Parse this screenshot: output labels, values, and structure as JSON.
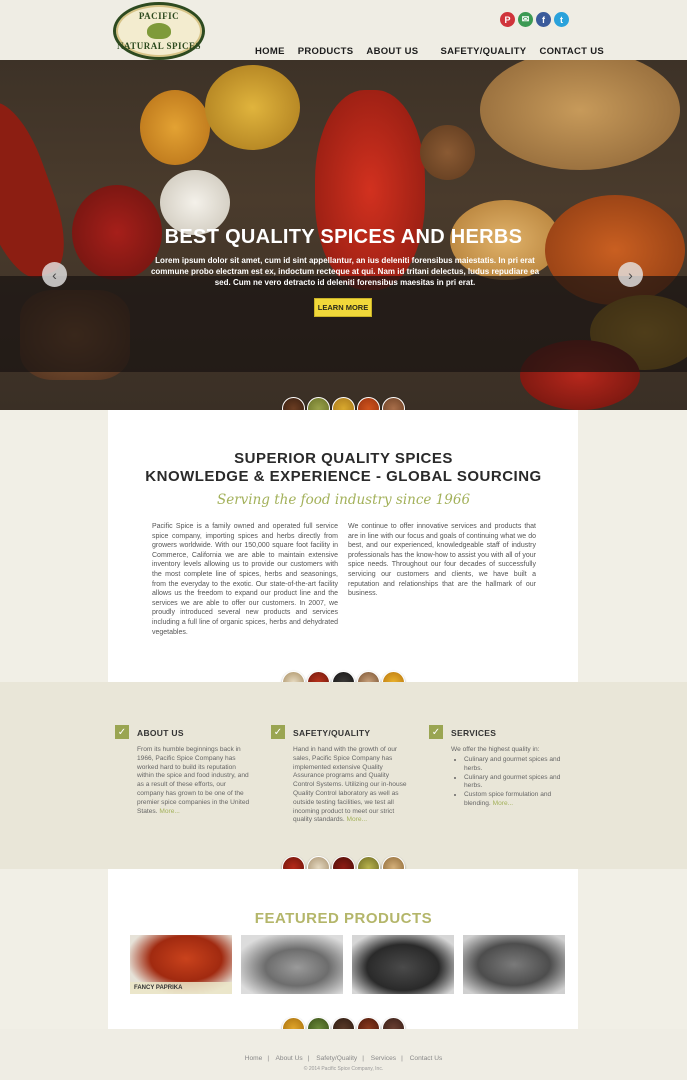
{
  "brand": {
    "logo_line1": "PACIFIC",
    "logo_line2": "NATURAL SPICES"
  },
  "nav": [
    "HOME",
    "PRODUCTS",
    "ABOUT US",
    "SAFETY/QUALITY",
    "CONTACT US"
  ],
  "social": [
    {
      "icon": "pinterest-icon",
      "glyph": "P",
      "color": "#d0343b"
    },
    {
      "icon": "email-icon",
      "glyph": "✉",
      "color": "#3c9a53"
    },
    {
      "icon": "facebook-icon",
      "glyph": "f",
      "color": "#3b5b9b"
    },
    {
      "icon": "twitter-icon",
      "glyph": "t",
      "color": "#2aa2db"
    }
  ],
  "hero": {
    "title": "BEST QUALITY SPICES AND HERBS",
    "text": "Lorem ipsum dolor sit amet, cum id sint appellantur, an ius deleniti forensibus maiestatis. In pri erat commune probo electram est ex, indoctum recteque at qui. Nam id tritani delectus, ludus repudiare ea sed. Cum ne vero detracto id deleniti forensibus maesitas in pri erat.",
    "button": "LEARN MORE",
    "prev": "‹",
    "next": "›"
  },
  "intro": {
    "heading1": "SUPERIOR QUALITY SPICES",
    "heading2": "KNOWLEDGE & EXPERIENCE - GLOBAL SOURCING",
    "script": "Serving the food industry since 1966",
    "col1": "Pacific Spice is a family owned and operated full service spice company, importing spices and herbs directly from growers worldwide. With our 150,000 square foot facility in Commerce, California we are able to maintain extensive inventory levels allowing us to provide our customers with the most complete line of spices, herbs and seasonings, from the everyday to the exotic. Our state-of-the-art facility allows us the freedom to expand our product line and the services we are able to offer our customers. In 2007, we proudly introduced several new products and services including a full line of organic spices, herbs and dehydrated vegetables.",
    "col2": "We continue to offer innovative services and products that are in line with our focus and goals of continuing what we do best, and our experienced, knowledgeable staff of industry professionals has the know-how to assist you with all of your spice needs. Throughout our four decades of successfully servicing our customers and clients, we have built a reputation and relationships that are the hallmark of our business."
  },
  "features": {
    "about": {
      "title": "ABOUT US",
      "text": "From its humble beginnings back in 1966, Pacific Spice Company has worked hard to build its reputation within the spice and food industry, and as a result of these efforts, our company has grown to be one of the premier spice companies in the United States.",
      "more": "More..."
    },
    "safety": {
      "title": "SAFETY/QUALITY",
      "text": "Hand in hand with the growth of our sales, Pacific Spice Company has implemented extensive Quality Assurance programs and Quality Control Systems. Utilizing our in-house Quality Control laboratory as well as outside testing facilities, we test all incoming product to meet our strict quality standards.",
      "more": "More..."
    },
    "services": {
      "title": "SERVICES",
      "intro": "We offer the highest quality in:",
      "items": [
        "Culinary and gourmet spices and herbs.",
        "Culinary and gourmet spices and herbs.",
        "Custom spice formulation and blending."
      ],
      "more": "More..."
    }
  },
  "products": {
    "title": "FEATURED PRODUCTS",
    "items": [
      {
        "label": "FANCY PAPRIKA"
      },
      {
        "label": ""
      },
      {
        "label": ""
      },
      {
        "label": ""
      }
    ]
  },
  "footer": {
    "links": [
      "Home",
      "About Us",
      "Safety/Quality",
      "Services",
      "Contact Us"
    ],
    "copyright": "© 2014 Pacific Spice Company, Inc."
  },
  "colors": {
    "accent": "#a3b15a",
    "button": "#f1d83a",
    "product_title": "#b4b66a"
  }
}
